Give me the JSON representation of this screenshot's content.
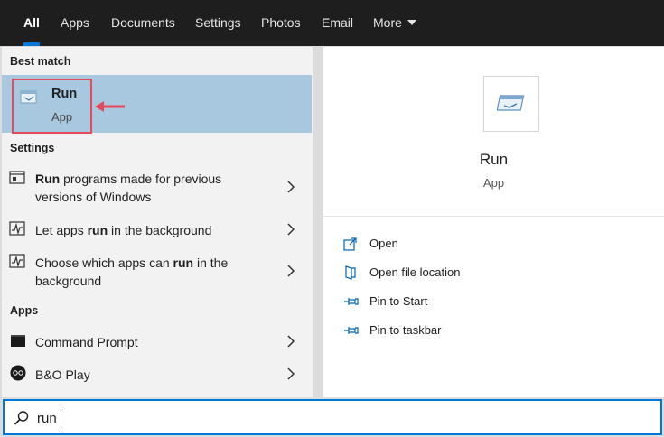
{
  "tabs": [
    {
      "label": "All",
      "active": true
    },
    {
      "label": "Apps"
    },
    {
      "label": "Documents"
    },
    {
      "label": "Settings"
    },
    {
      "label": "Photos"
    },
    {
      "label": "Email"
    },
    {
      "label": "More"
    }
  ],
  "sections": {
    "best_match": "Best match",
    "settings": "Settings",
    "apps": "Apps"
  },
  "best_match": {
    "title": "Run",
    "subtitle": "App",
    "icon": "run-app-icon"
  },
  "settings_items": [
    {
      "line1_bold": "Run",
      "line1_rest": " programs made for previous",
      "line2": "versions of Windows",
      "icon": "compat-window-icon"
    },
    {
      "pre": "Let apps ",
      "bold": "run",
      "post": " in the background",
      "icon": "activity-icon"
    },
    {
      "pre": "Choose which apps can ",
      "bold": "run",
      "post": " in the",
      "line2": "background",
      "icon": "activity-icon"
    }
  ],
  "apps_items": [
    {
      "label": "Command Prompt",
      "icon": "terminal-icon"
    },
    {
      "label": "B&O Play",
      "icon": "bo-play-icon"
    }
  ],
  "preview": {
    "name": "Run",
    "type": "App",
    "actions": [
      {
        "label": "Open",
        "icon": "open-icon"
      },
      {
        "label": "Open file location",
        "icon": "file-location-icon"
      },
      {
        "label": "Pin to Start",
        "icon": "pin-icon"
      },
      {
        "label": "Pin to taskbar",
        "icon": "pin-icon"
      }
    ]
  },
  "search": {
    "value": "run"
  },
  "colors": {
    "accent": "#0078d7",
    "selection": "#a8c8e0",
    "highlight": "#e34a5c",
    "nav": "#1e1e1e"
  }
}
